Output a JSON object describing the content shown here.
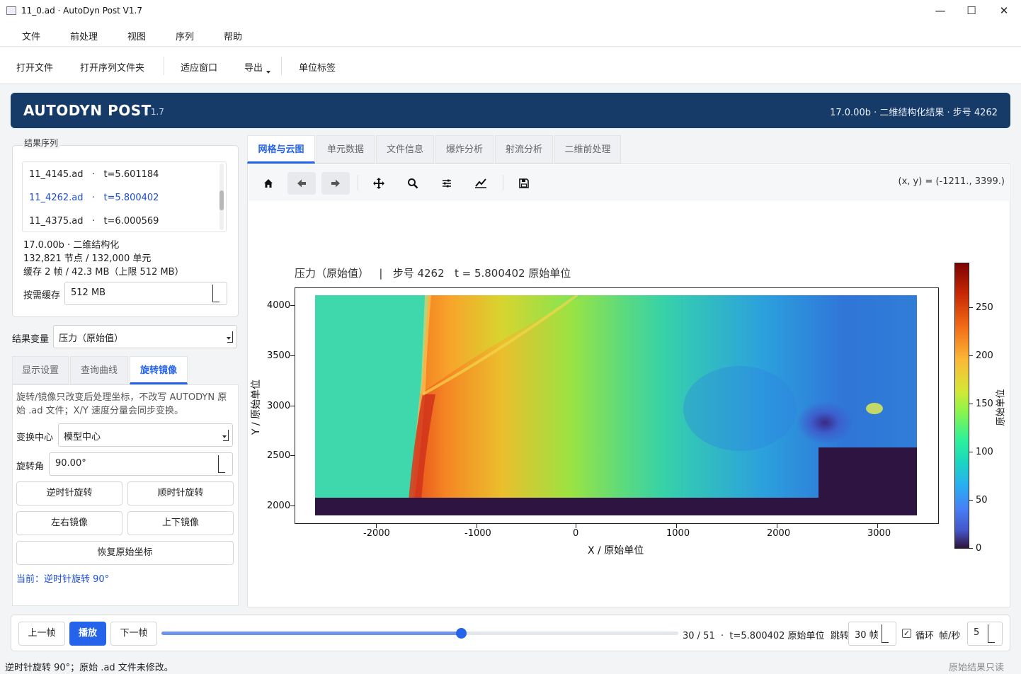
{
  "window": {
    "title": "11_0.ad · AutoDyn Post V1.7",
    "minimize": "—",
    "maximize": "☐",
    "close": "✕"
  },
  "menu": {
    "items": [
      "文件",
      "前处理",
      "视图",
      "序列",
      "帮助"
    ]
  },
  "toolbar": {
    "open_file": "打开文件",
    "open_folder": "打开序列文件夹",
    "fit_window": "适应窗口",
    "export": "导出",
    "unit_label": "单位标签"
  },
  "banner": {
    "brand": "AUTODYN POST",
    "version": "/ 1.7",
    "info": "17.0.00b · 二维结构化结果 · 步号 4262"
  },
  "sequence": {
    "title": "结果序列",
    "items": [
      {
        "name": "11_4145.ad",
        "sep": "·",
        "time": "t=5.601184"
      },
      {
        "name": "11_4262.ad",
        "sep": "·",
        "time": "t=5.800402"
      },
      {
        "name": "11_4375.ad",
        "sep": "·",
        "time": "t=6.000569"
      }
    ],
    "meta1": "17.0.00b · 二维结构化",
    "meta2": "132,821 节点 / 132,000 单元",
    "meta3": "缓存 2 帧 / 42.3 MB（上限 512 MB）",
    "cache_label": "按需缓存",
    "cache_value": "512 MB"
  },
  "variable": {
    "label": "结果变量",
    "value": "压力（原始值）"
  },
  "left_tabs": [
    "显示设置",
    "查询曲线",
    "旋转镜像"
  ],
  "rotate": {
    "desc": "旋转/镜像只改变后处理坐标，不改写 AUTODYN 原始 .ad 文件；X/Y 速度分量会同步变换。",
    "center_label": "变换中心",
    "center_value": "模型中心",
    "angle_label": "旋转角",
    "angle_value": "90.00°",
    "ccw": "逆时针旋转",
    "cw": "顺时针旋转",
    "mirror_lr": "左右镜像",
    "mirror_ud": "上下镜像",
    "restore": "恢复原始坐标",
    "current": "当前：逆时针旋转 90°"
  },
  "main_tabs": [
    "网格与云图",
    "单元数据",
    "文件信息",
    "爆炸分析",
    "射流分析",
    "二维前处理"
  ],
  "plot_toolbar": {
    "coords": "(x, y) = (-1211., 3399.)",
    "icons": [
      "home-icon",
      "back-icon",
      "forward-icon",
      "pan-icon",
      "zoom-icon",
      "configure-icon",
      "edit-curve-icon",
      "save-icon"
    ]
  },
  "plot": {
    "title_var": "压力（原始值）",
    "title_sep": "|",
    "title_step": "步号 4262",
    "title_time": "t = 5.800402 原始单位",
    "xlabel": "X / 原始单位",
    "ylabel": "Y / 原始单位",
    "xticks": [
      "-2000",
      "-1000",
      "0",
      "1000",
      "2000",
      "3000"
    ],
    "yticks": [
      "4000",
      "3500",
      "3000",
      "2500",
      "2000"
    ],
    "cbar_ticks": [
      "250",
      "200",
      "150",
      "100",
      "50",
      "0"
    ],
    "cbar_label": "原始单位",
    "colors": {
      "bg_fluid": "#3fd8ac",
      "front_hot": "#f36b1f",
      "ground": "#2e1541",
      "low": "#3b6fd9"
    }
  },
  "playback": {
    "prev": "上一帧",
    "play": "播放",
    "next": "下一帧",
    "progress": 0.58,
    "frame": "30 / 51",
    "sep": "·",
    "time": "t=5.800402 原始单位",
    "jump_label": "跳转",
    "jump_value": "30 帧",
    "loop_label": "循环",
    "fps_label": "帧/秒",
    "fps_value": "5"
  },
  "status": {
    "left": "逆时针旋转 90°；原始 .ad 文件未修改。",
    "right": "原始结果只读"
  }
}
